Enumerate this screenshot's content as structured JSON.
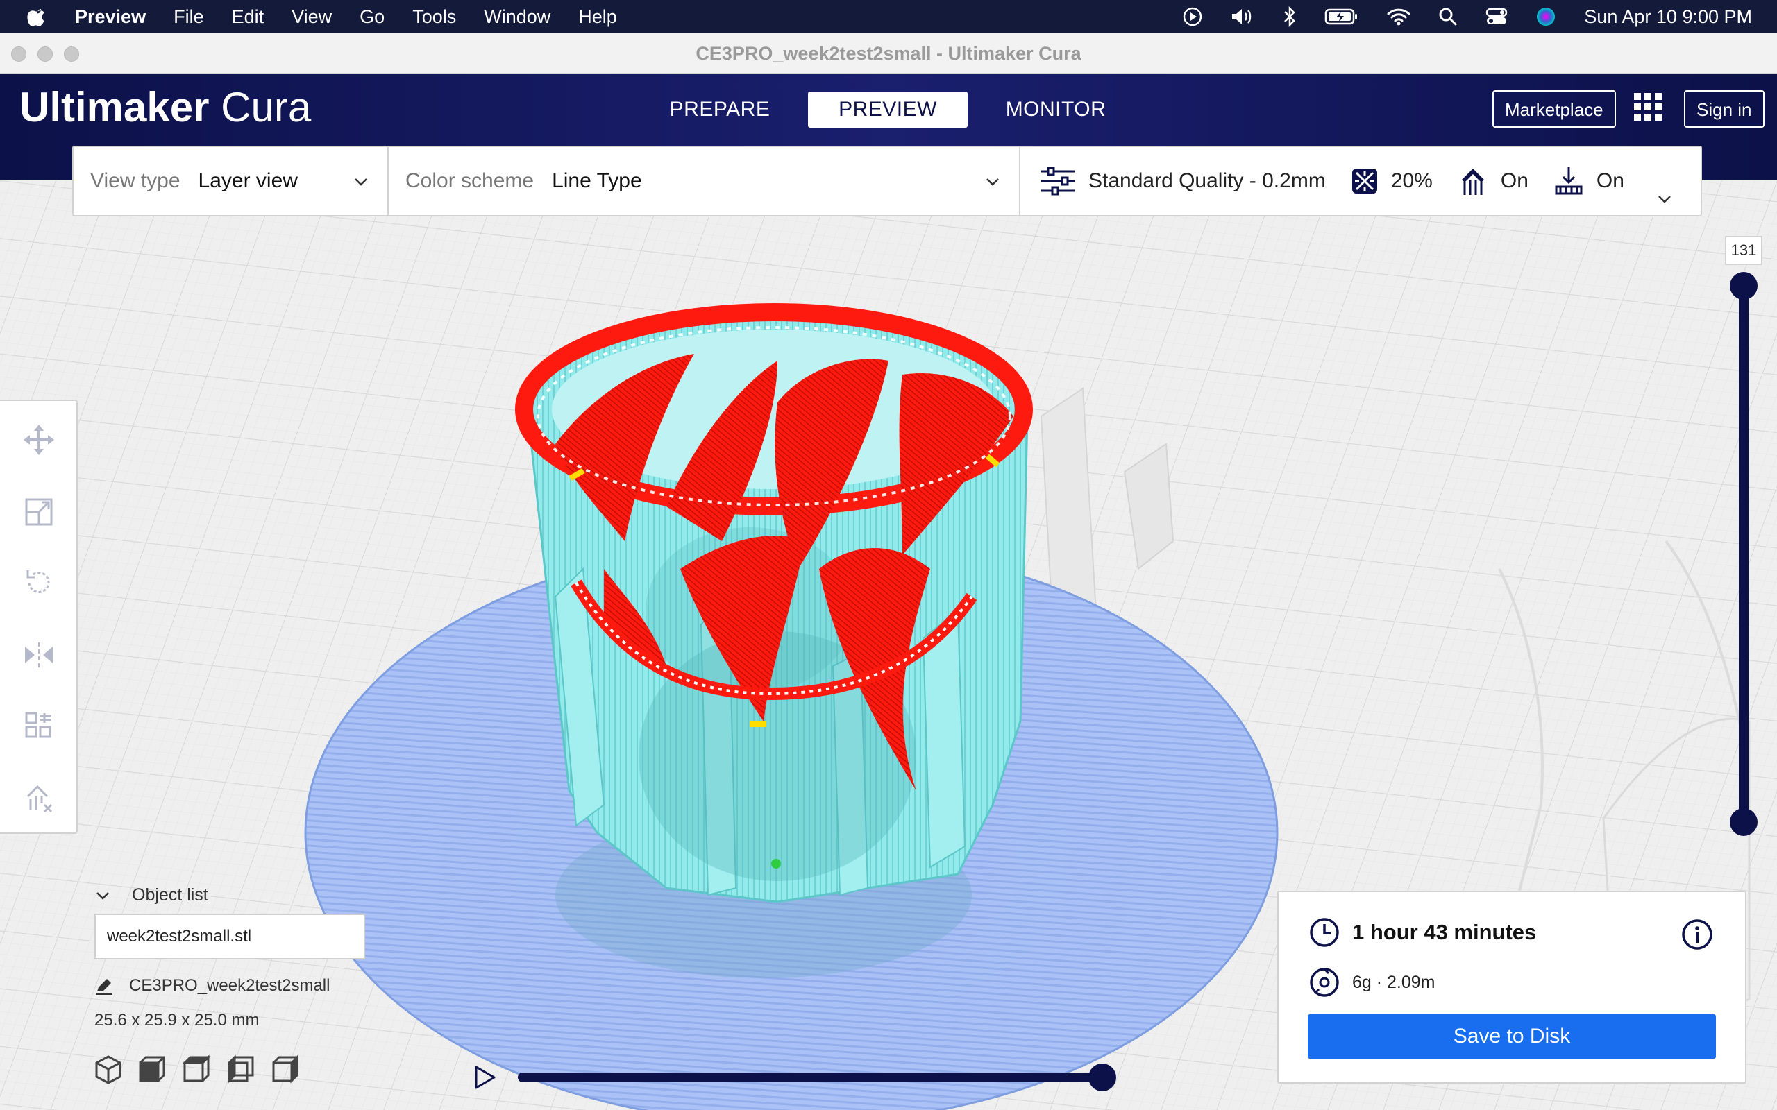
{
  "menubar": {
    "app_name": "Preview",
    "items": [
      "File",
      "Edit",
      "View",
      "Go",
      "Tools",
      "Window",
      "Help"
    ],
    "clock": "Sun Apr 10  9:00 PM"
  },
  "window": {
    "title": "CE3PRO_week2test2small - Ultimaker Cura"
  },
  "header": {
    "logo_bold": "Ultimaker",
    "logo_light": " Cura",
    "tabs": [
      "PREPARE",
      "PREVIEW",
      "MONITOR"
    ],
    "active_tab": "PREVIEW",
    "marketplace": "Marketplace",
    "sign_in": "Sign in"
  },
  "settings": {
    "view_type_label": "View type",
    "view_type_value": "Layer view",
    "color_scheme_label": "Color scheme",
    "color_scheme_value": "Line Type",
    "quality": "Standard Quality - 0.2mm",
    "infill": "20%",
    "support": "On",
    "adhesion": "On"
  },
  "object_list": {
    "header": "Object list",
    "file": "week2test2small.stl",
    "job_name": "CE3PRO_week2test2small",
    "dimensions": "25.6 x 25.9 x 25.0 mm"
  },
  "layer_slider": {
    "current_layer": "131"
  },
  "print_info": {
    "time": "1 hour 43 minutes",
    "material": "6g · 2.09m",
    "save": "Save to Disk"
  },
  "colors": {
    "navy": "#0c1149",
    "accent_blue": "#196ef0",
    "skin_red": "#ff1a0f",
    "wall_cyan": "#8fe8e8",
    "raft_blue": "#a8c0f5"
  }
}
